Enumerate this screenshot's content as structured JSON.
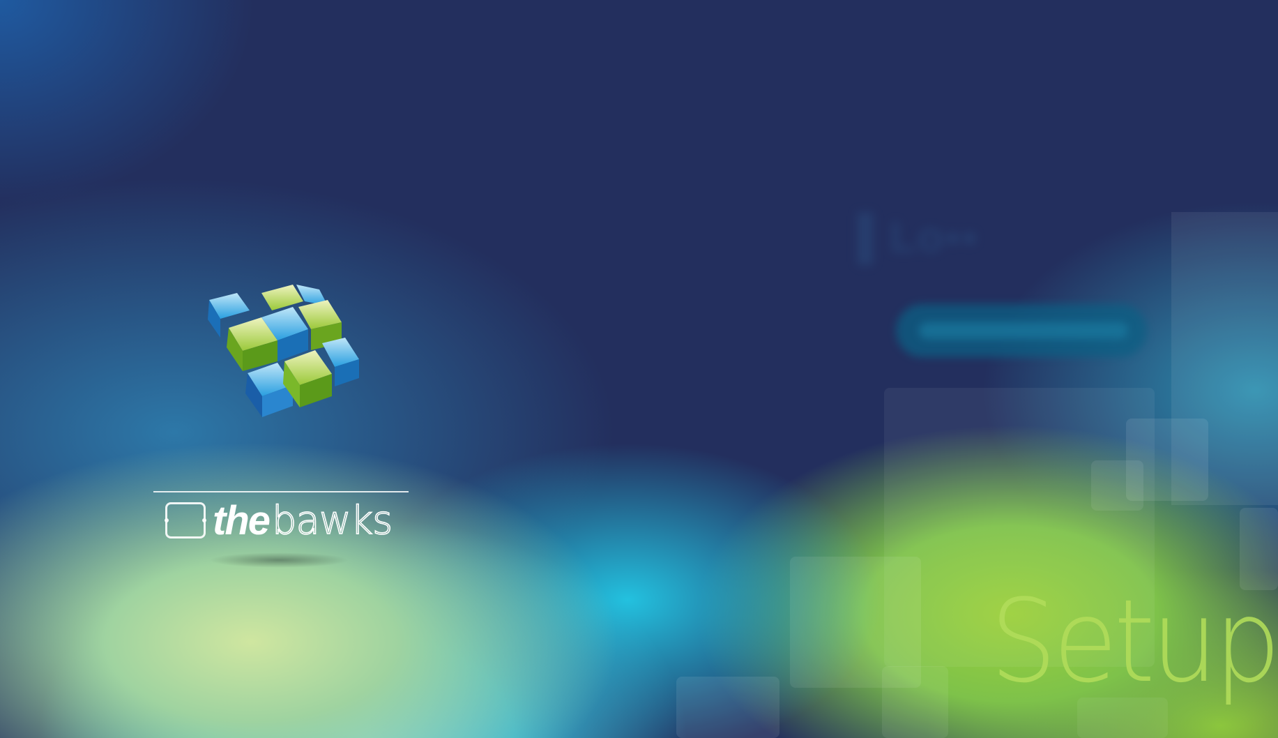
{
  "brand": {
    "logo_name": "thebawks",
    "word_the": "the",
    "word_bawks": "bawks",
    "cube_colors": {
      "blue": "#2a9fe0",
      "green": "#9bc93a",
      "light_green": "#d7e69a",
      "light_blue": "#a9d9f2"
    }
  },
  "background_text": {
    "setup": "Setup"
  },
  "colors": {
    "navy": "#232f5e",
    "cyan": "#23c1df",
    "lime": "#9bd03a"
  }
}
